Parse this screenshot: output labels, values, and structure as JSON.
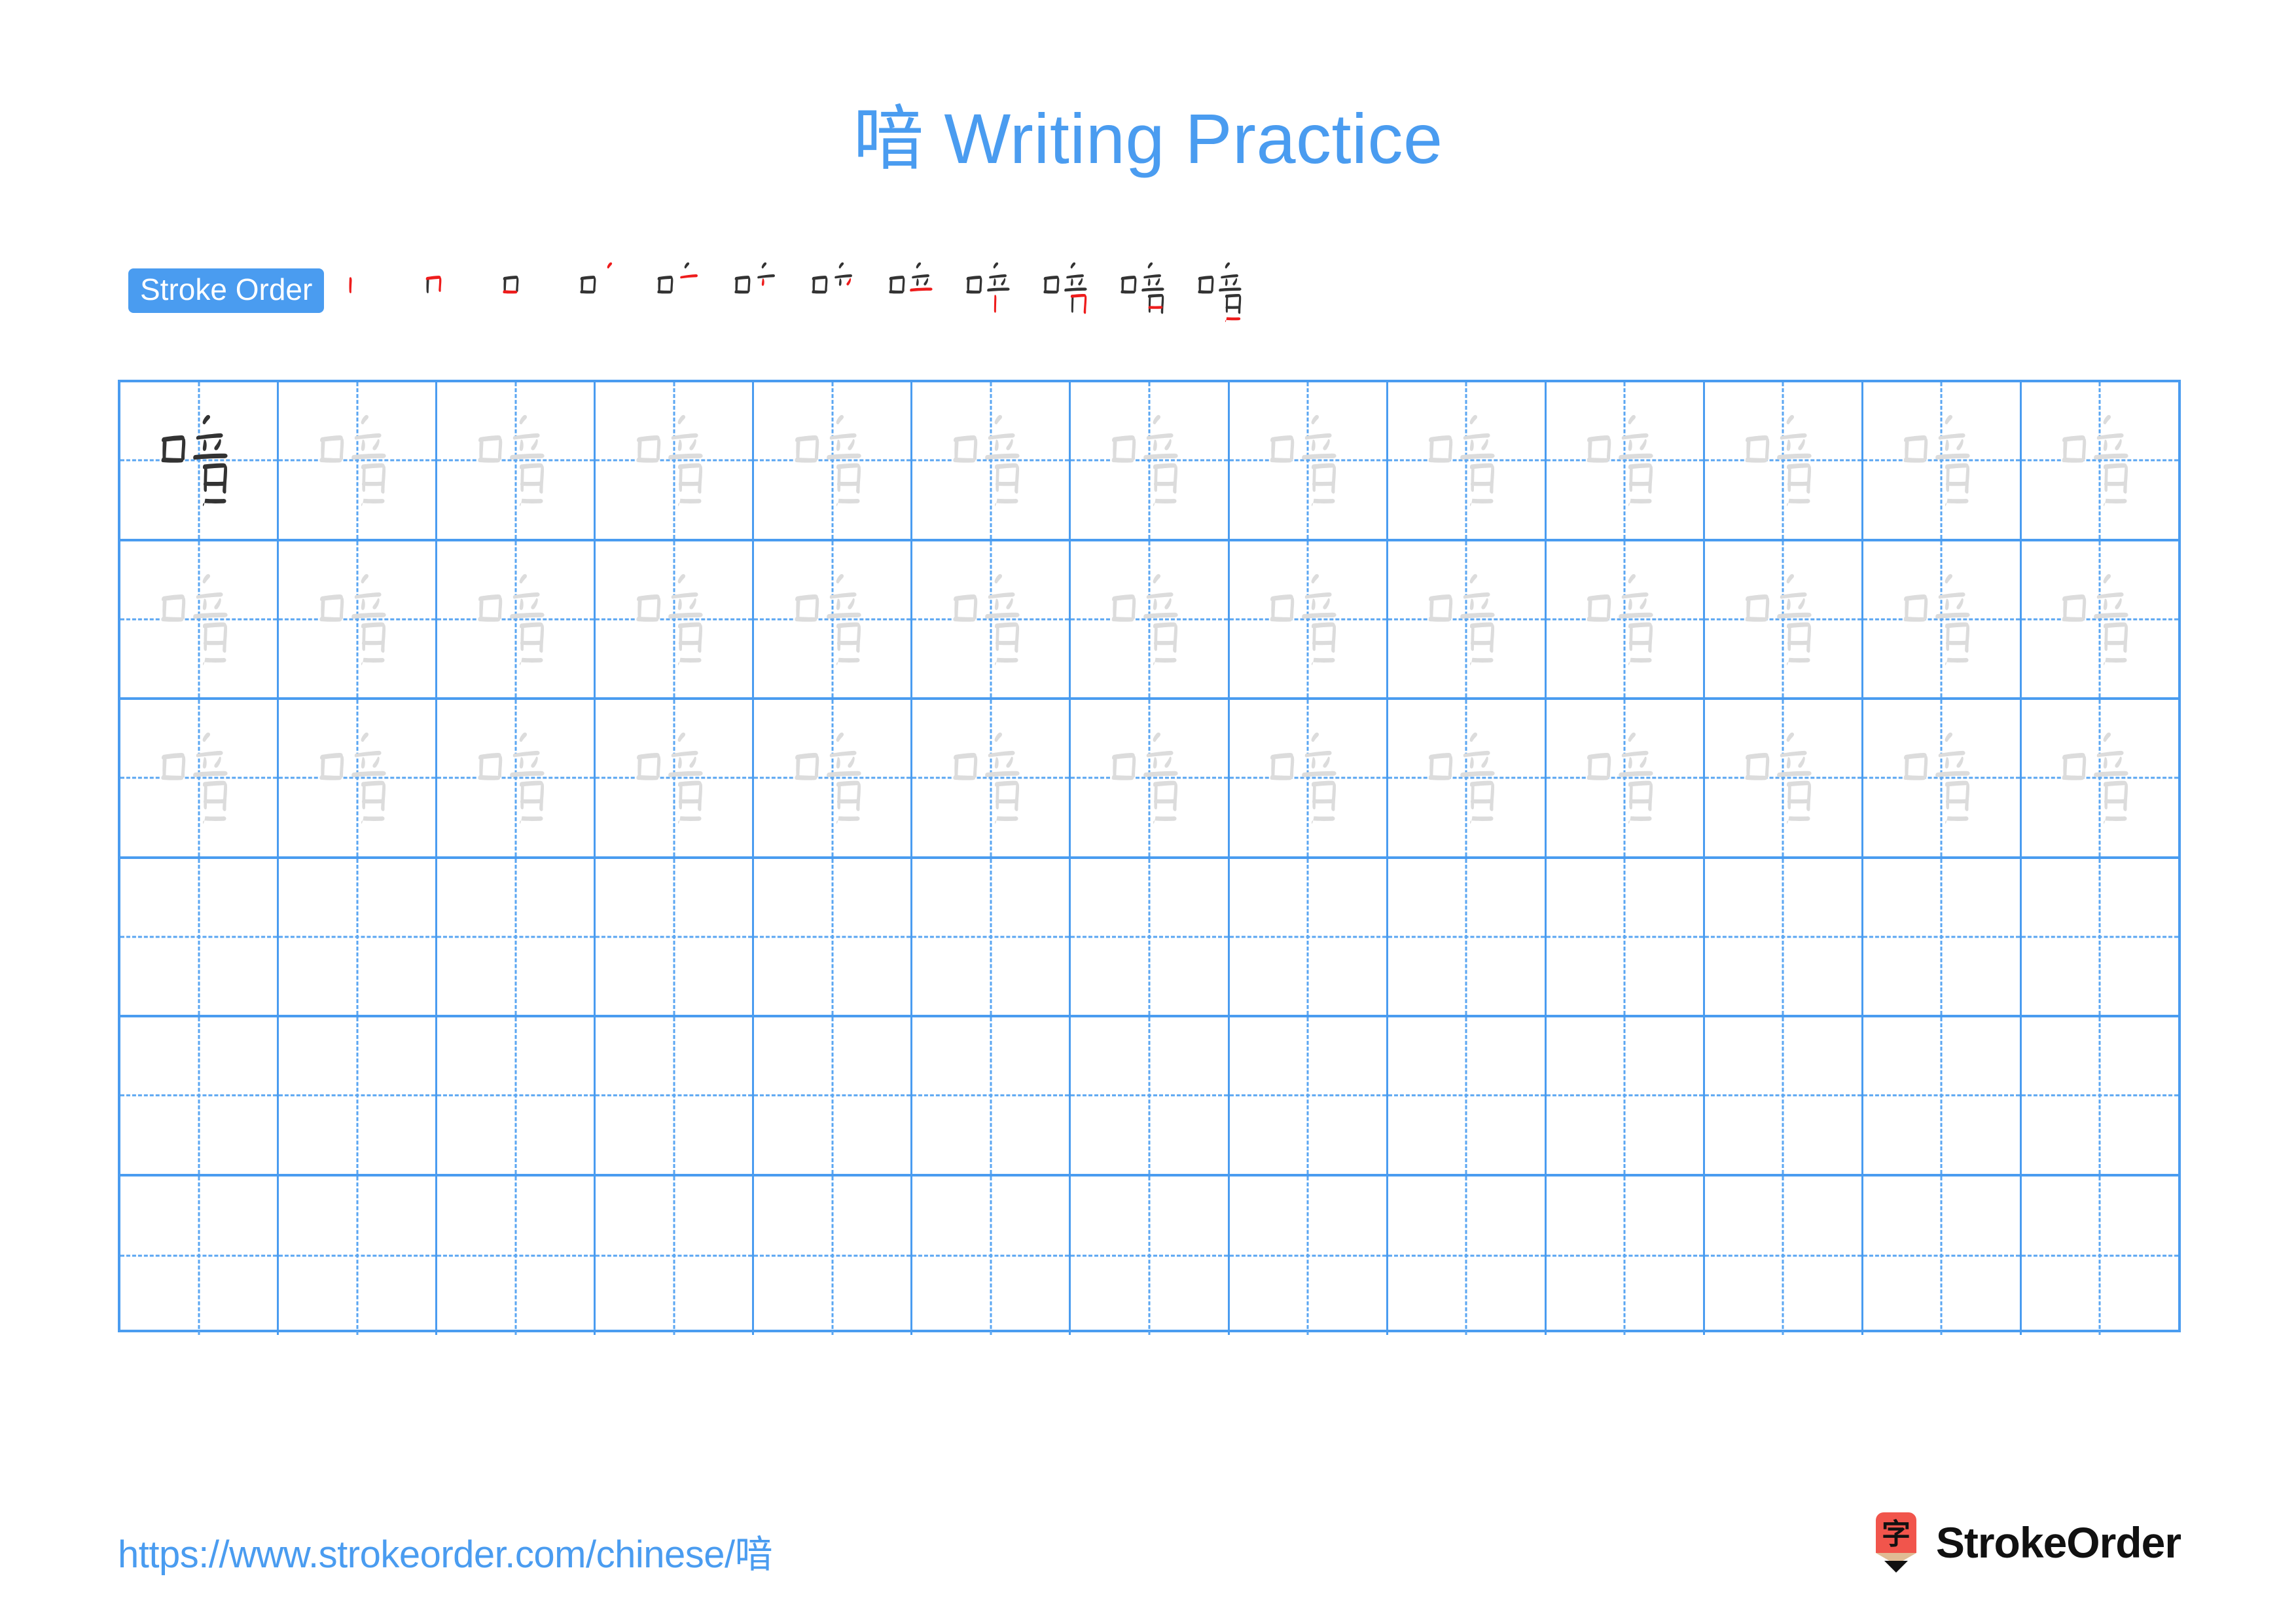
{
  "document": {
    "character": "喑",
    "title": "喑 Writing Practice",
    "background_color": "#ffffff",
    "accent_color": "#4a9cf0"
  },
  "header": {
    "title": "喑 Writing Practice"
  },
  "stroke_order": {
    "badge_label": "Stroke Order",
    "badge_bg": "#4a9cf0",
    "badge_text_color": "#ffffff",
    "total_strokes": 12,
    "completed_stroke_color": "#333333",
    "current_stroke_color": "#ee1c1c",
    "steps": [
      {
        "index": 1,
        "partial": "丨"
      },
      {
        "index": 2,
        "partial": "冂"
      },
      {
        "index": 3,
        "partial": "口"
      },
      {
        "index": 4,
        "partial": "口丶"
      },
      {
        "index": 5,
        "partial": "口亠"
      },
      {
        "index": 6,
        "partial": "口𧘇"
      },
      {
        "index": 7,
        "partial": "口䒑"
      },
      {
        "index": 8,
        "partial": "口立"
      },
      {
        "index": 9,
        "partial": "啦"
      },
      {
        "index": 10,
        "partial": "唘"
      },
      {
        "index": 11,
        "partial": "喑"
      },
      {
        "index": 12,
        "partial": "喑"
      }
    ]
  },
  "practice_grid": {
    "columns": 13,
    "rows": 6,
    "grid_line_color": "#4a9cf0",
    "guide_line_color": "#5aa6f2",
    "model_character_color": "#333333",
    "trace_character_color": "#dcdcdc",
    "rows_data": [
      {
        "row": 1,
        "cells": [
          "model",
          "trace",
          "trace",
          "trace",
          "trace",
          "trace",
          "trace",
          "trace",
          "trace",
          "trace",
          "trace",
          "trace",
          "trace"
        ]
      },
      {
        "row": 2,
        "cells": [
          "trace",
          "trace",
          "trace",
          "trace",
          "trace",
          "trace",
          "trace",
          "trace",
          "trace",
          "trace",
          "trace",
          "trace",
          "trace"
        ]
      },
      {
        "row": 3,
        "cells": [
          "trace",
          "trace",
          "trace",
          "trace",
          "trace",
          "trace",
          "trace",
          "trace",
          "trace",
          "trace",
          "trace",
          "trace",
          "trace"
        ]
      },
      {
        "row": 4,
        "cells": [
          "empty",
          "empty",
          "empty",
          "empty",
          "empty",
          "empty",
          "empty",
          "empty",
          "empty",
          "empty",
          "empty",
          "empty",
          "empty"
        ]
      },
      {
        "row": 5,
        "cells": [
          "empty",
          "empty",
          "empty",
          "empty",
          "empty",
          "empty",
          "empty",
          "empty",
          "empty",
          "empty",
          "empty",
          "empty",
          "empty"
        ]
      },
      {
        "row": 6,
        "cells": [
          "empty",
          "empty",
          "empty",
          "empty",
          "empty",
          "empty",
          "empty",
          "empty",
          "empty",
          "empty",
          "empty",
          "empty",
          "empty"
        ]
      }
    ]
  },
  "footer": {
    "url": "https://www.strokeorder.com/chinese/喑",
    "brand_name": "StrokeOrder",
    "logo_character": "字",
    "logo_body_color": "#f1554c",
    "logo_wood_color": "#e0bc94",
    "logo_tip_color": "#111111"
  }
}
